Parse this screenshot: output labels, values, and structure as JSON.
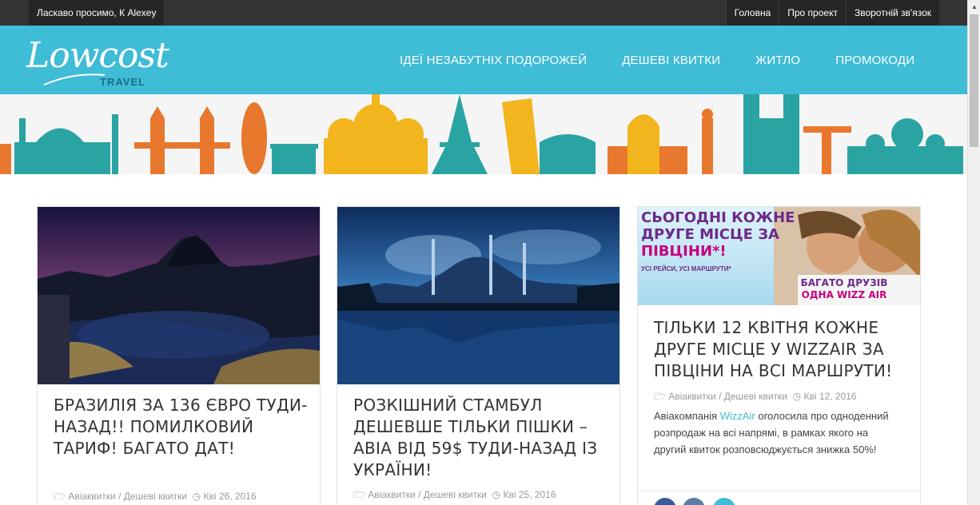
{
  "topbar": {
    "welcome": "Ласкаво просимо, К Alexey",
    "links": [
      "Головна",
      "Про проект",
      "Зворотній зв'язок"
    ]
  },
  "header": {
    "logo_main": "Lowcost",
    "logo_sub": "TRAVEL",
    "nav": [
      "ІДЕЇ НЕЗАБУТНІХ ПОДОРОЖЕЙ",
      "ДЕШЕВІ КВИТКИ",
      "ЖИТЛО",
      "ПРОМОКОДИ"
    ]
  },
  "posts": [
    {
      "title": "БРАЗИЛІЯ ЗА 136 ЄВРО ТУДИ-НАЗАД!! ПОМИЛКОВИЙ ТАРИФ! БАГАТО ДАТ!",
      "categories": "Авіаквитки / Дешеві квитки",
      "date": "Кві 26, 2016"
    },
    {
      "title": "РОЗКІШНИЙ СТАМБУЛ ДЕШЕВШЕ ТІЛЬКИ ПІШКИ – АВІА ВІД 59$ ТУДИ-НАЗАД ІЗ УКРАЇНИ!",
      "categories": "Авіаквитки / Дешеві квитки",
      "date": "Кві 25, 2016"
    },
    {
      "title": "ТІЛЬКИ 12 КВІТНЯ КОЖНЕ ДРУГЕ МІСЦЕ У WIZZAIR ЗА ПІВЦІНИ НА ВСІ МАРШРУТИ!",
      "categories": "Авіаквитки / Дешеві квитки",
      "date": "Кві 12, 2016",
      "excerpt_before": "Авіакомпанія ",
      "excerpt_link": "WizzAir",
      "excerpt_after": " оголосила про одноденний розпродаж на всі напрямі, в рамках якого на другий квиток розповсюджується знижка 50%!",
      "ad": {
        "headline_1": "СЬОГОДНІ КОЖНЕ",
        "headline_2": "ДРУГЕ МІСЦЕ ЗА",
        "headline_3": "ПІВЦІНИ*!",
        "small": "УСІ РЕЙСИ, УСІ МАРШРУТИ*",
        "badge_1": "БАГАТО ДРУЗІВ",
        "badge_2": "ОДНА WIZZ AIR"
      }
    }
  ],
  "colors": {
    "topbar": "#333333",
    "header": "#3fbcd6",
    "accent": "#3fbcd6",
    "wizz_pink": "#c6007e",
    "wizz_purple": "#6b2b8a"
  }
}
